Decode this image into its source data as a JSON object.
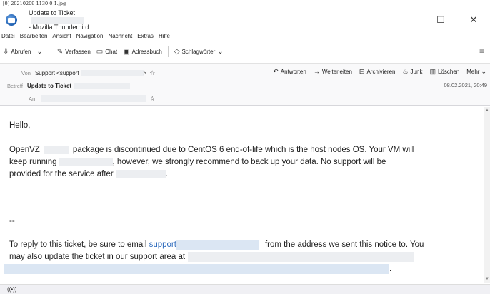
{
  "caption": "[0] 20210209-1130-0-1.jpg",
  "window": {
    "title_prefix": "Update to Ticket",
    "title_suffix": "- Mozilla Thunderbird",
    "controls": {
      "minimize": "—",
      "maximize": "☐",
      "close": "✕"
    }
  },
  "menu": [
    "Datei",
    "Bearbeiten",
    "Ansicht",
    "Navigation",
    "Nachricht",
    "Extras",
    "Hilfe"
  ],
  "toolbar": {
    "get_mail": "Abrufen",
    "compose": "Verfassen",
    "chat": "Chat",
    "address_book": "Adressbuch",
    "tags": "Schlagwörter",
    "menu_icon": "hamburger-icon"
  },
  "header": {
    "from_label": "Von",
    "from_value": "Support <support",
    "subject_label": "Betreff",
    "subject_value": "Update to Ticket",
    "to_label": "An",
    "date": "08.02.2021, 20:49",
    "actions": {
      "reply": "Antworten",
      "forward": "Weiterleiten",
      "archive": "Archivieren",
      "junk": "Junk",
      "delete": "Löschen",
      "more": "Mehr"
    }
  },
  "message": {
    "greeting": "Hello,",
    "p1_a": "OpenVZ",
    "p1_b": "package is discontinued due to CentOS 6 end-of-life which is the host nodes OS. Your VM will",
    "p1_c": "keep running",
    "p1_d": ", however, we strongly recommend to back up your data. No support will be",
    "p1_e": "provided for the service after",
    "p1_f": ".",
    "sig": "--",
    "p2_a": "To reply to this ticket, be sure to email",
    "p2_link": "support",
    "p2_b": "from the address we sent this notice to. You",
    "p2_c": "may also update the ticket in our support area at",
    "p2_d": "."
  },
  "status": {
    "activity_icon": "((•))"
  }
}
